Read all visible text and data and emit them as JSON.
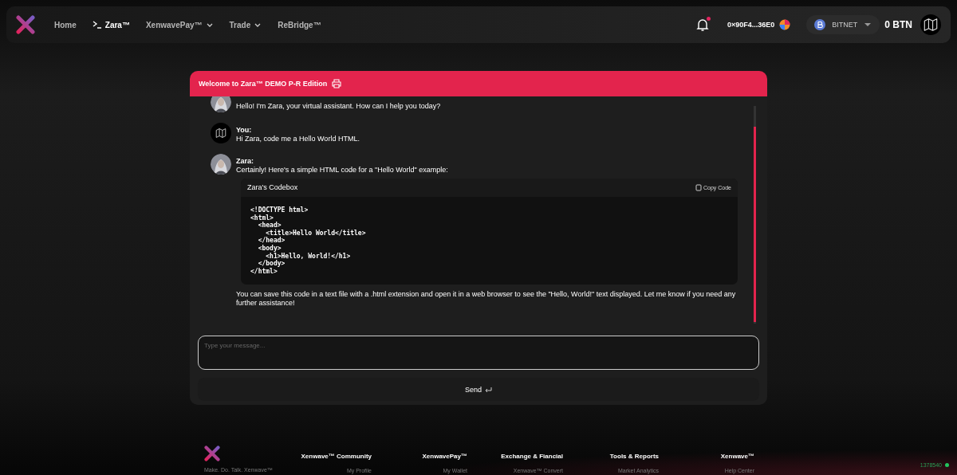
{
  "nav": {
    "items": [
      {
        "label": "Home",
        "kind": "link",
        "selected": false
      },
      {
        "label": "Zara™",
        "kind": "terminal",
        "selected": true
      },
      {
        "label": "XenwavePay™",
        "kind": "dropdown",
        "selected": false
      },
      {
        "label": "Trade",
        "kind": "dropdown",
        "selected": false
      },
      {
        "label": "ReBridge™",
        "kind": "link",
        "selected": false
      }
    ],
    "notifications": {
      "unread": true
    },
    "wallet_address": "0×90F4...36E0",
    "network": "BITNET",
    "balance": "0 BTN"
  },
  "chat": {
    "title": "Welcome to Zara™ DEMO P-R Edition",
    "messages": [
      {
        "kind": "zara",
        "text": "Hello! I'm Zara, your virtual assistant. How can I help you today?"
      },
      {
        "kind": "user",
        "name": "You:",
        "text": "Hi Zara, code me a Hello World HTML."
      },
      {
        "kind": "zara",
        "name": "Zara:",
        "text": "Certainly! Here's a simple HTML code for a \"Hello World\" example:",
        "codebox": {
          "title": "Zara's Codebox",
          "copy_label": "Copy Code",
          "code": "<!DOCTYPE html>\n<html>\n  <head>\n    <title>Hello World</title>\n  </head>\n  <body>\n    <h1>Hello, World!</h1>\n  </body>\n</html>"
        },
        "after": "You can save this code in a text file with a .html extension and open it in a web browser to see the \"Hello, World!\" text displayed. Let me know if you need any further assistance!"
      }
    ],
    "input": {
      "placeholder": "Type your message..."
    },
    "send_label": "Send"
  },
  "footer": {
    "tagline": "Make. Do. Talk. Xenwave™",
    "columns": [
      {
        "heading": "Xenwave™ Community",
        "link": "My Profile"
      },
      {
        "heading": "XenwavePay™",
        "link": "My Wallet"
      },
      {
        "heading": "Exchange & Fiancial",
        "link": "Xenwave™ Convert"
      },
      {
        "heading": "Tools & Reports",
        "link": "Market Analytics"
      },
      {
        "heading": "Xenwave™",
        "link": "Help Center"
      }
    ],
    "block": {
      "number": "1378540",
      "color": "#22c55e"
    }
  }
}
